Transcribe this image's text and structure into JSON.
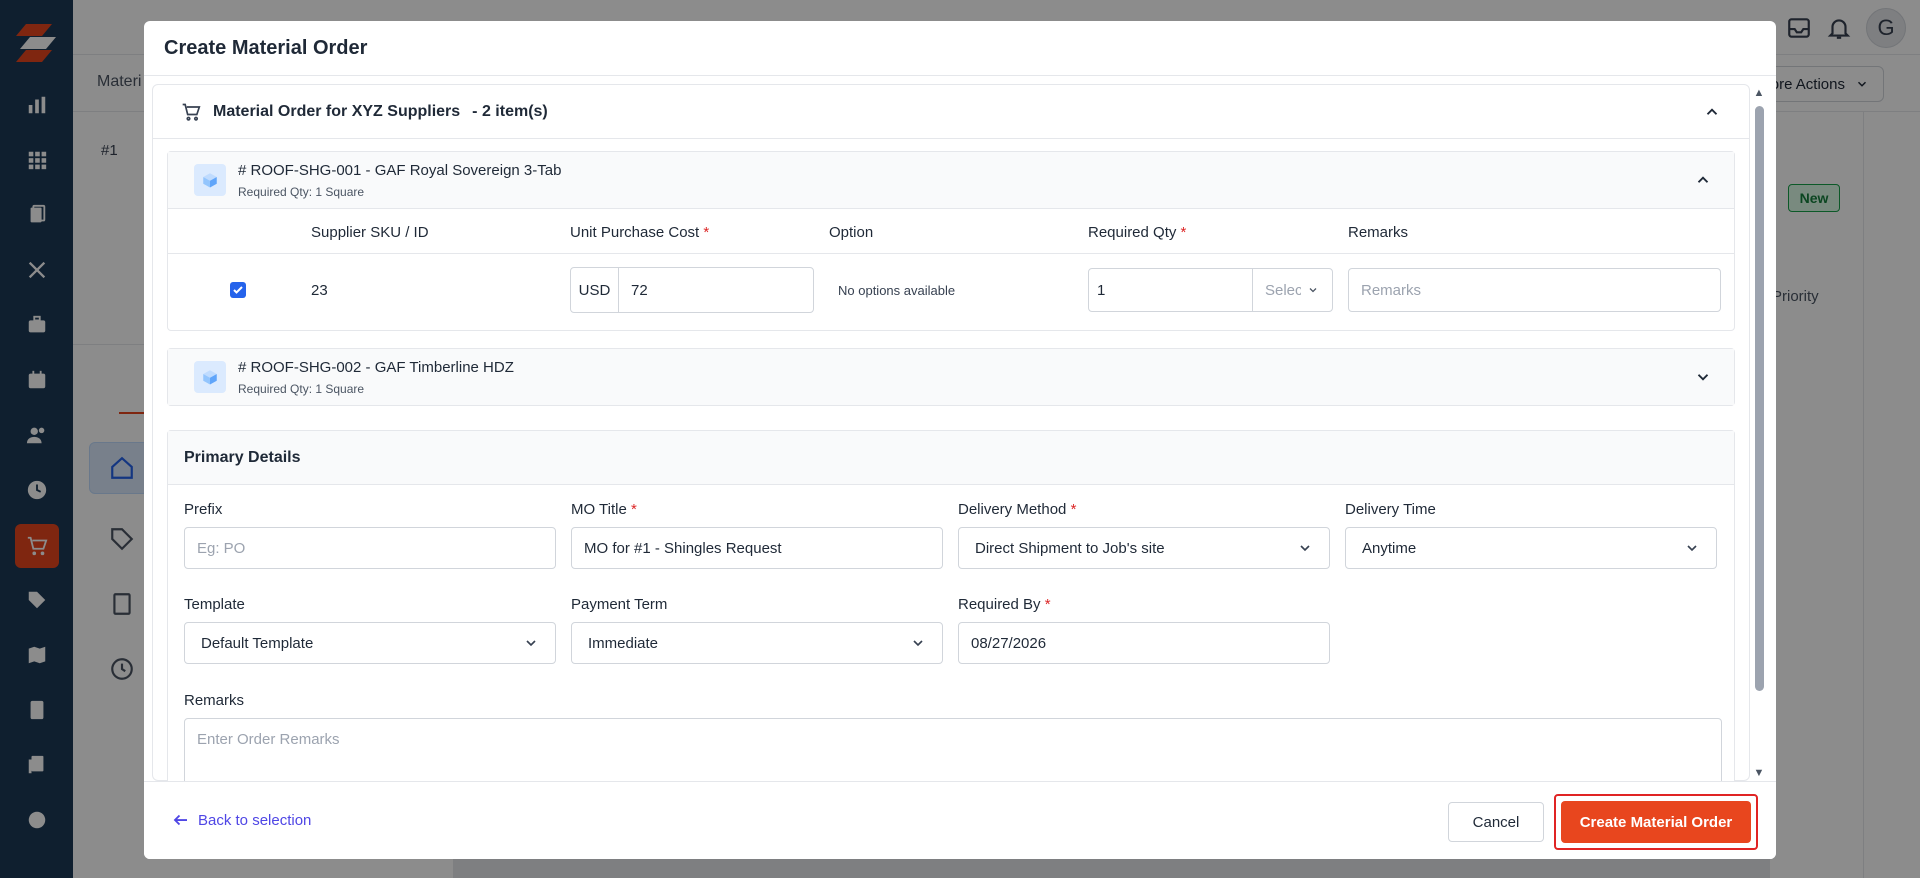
{
  "background": {
    "breadcrumb": "Materi",
    "record_number": "#1",
    "more_actions_label": "More Actions",
    "status_badge": "New",
    "priority_label": "Priority",
    "avatar_initial": "G"
  },
  "modal": {
    "title": "Create Material Order",
    "supplier": {
      "title": "Material Order for XYZ Suppliers",
      "count": "- 2 item(s)"
    },
    "items": [
      {
        "title": "# ROOF-SHG-001 - GAF Royal Sovereign 3-Tab",
        "required_qty": "Required Qty: 1 Square",
        "expanded": true,
        "columns": {
          "sku": "Supplier SKU / ID",
          "cost": "Unit Purchase Cost",
          "option": "Option",
          "qty": "Required Qty",
          "remarks": "Remarks"
        },
        "row": {
          "checked": true,
          "sku": "23",
          "currency": "USD",
          "cost": "72",
          "option": "No options available",
          "qty": "1",
          "unit_placeholder": "Select",
          "remarks_placeholder": "Remarks"
        }
      },
      {
        "title": "# ROOF-SHG-002 - GAF Timberline HDZ",
        "required_qty": "Required Qty: 1 Square",
        "expanded": false
      }
    ],
    "primary_details": {
      "heading": "Primary Details",
      "prefix_label": "Prefix",
      "prefix_placeholder": "Eg: PO",
      "mo_title_label": "MO Title",
      "mo_title_value": "MO for #1 - Shingles Request",
      "delivery_method_label": "Delivery Method",
      "delivery_method_value": "Direct Shipment to Job's site",
      "delivery_time_label": "Delivery Time",
      "delivery_time_value": "Anytime",
      "template_label": "Template",
      "template_value": "Default Template",
      "payment_term_label": "Payment Term",
      "payment_term_value": "Immediate",
      "required_by_label": "Required By",
      "required_by_value": "08/27/2026",
      "remarks_label": "Remarks",
      "remarks_placeholder": "Enter Order Remarks"
    },
    "footer": {
      "back_label": "Back to selection",
      "cancel_label": "Cancel",
      "create_label": "Create Material Order"
    }
  },
  "colors": {
    "sidebar": "#1d3a57",
    "accent": "#e8461e",
    "link": "#4f46e5",
    "required": "#dc2626"
  }
}
